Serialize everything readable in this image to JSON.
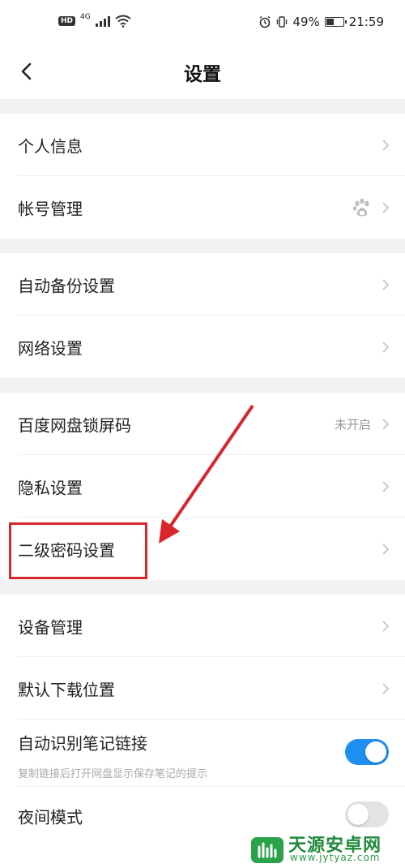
{
  "status_bar": {
    "hd": "HD",
    "network": "4G",
    "battery_text": "49%",
    "battery_level": 0.49,
    "time": "21:59"
  },
  "nav": {
    "title": "设置"
  },
  "settings": {
    "personal_info": "个人信息",
    "account_management": "帐号管理",
    "auto_backup": "自动备份设置",
    "network": "网络设置",
    "lock_screen": "百度网盘锁屏码",
    "lock_screen_status": "未开启",
    "privacy": "隐私设置",
    "secondary_password": "二级密码设置",
    "device_management": "设备管理",
    "default_download": "默认下载位置",
    "auto_detect_links": "自动识别笔记链接",
    "auto_detect_links_desc": "复制链接后打开网盘显示保存笔记的提示",
    "night_mode": "夜间模式"
  },
  "toggles": {
    "auto_detect_links_on": true,
    "night_mode_on": false
  },
  "colors": {
    "accent": "#1e8ef0",
    "toggle_off": "#e3e3e3",
    "highlight": "#d9262c"
  },
  "watermark": {
    "name": "天源安卓网",
    "url": "www.jytyaz.com"
  }
}
